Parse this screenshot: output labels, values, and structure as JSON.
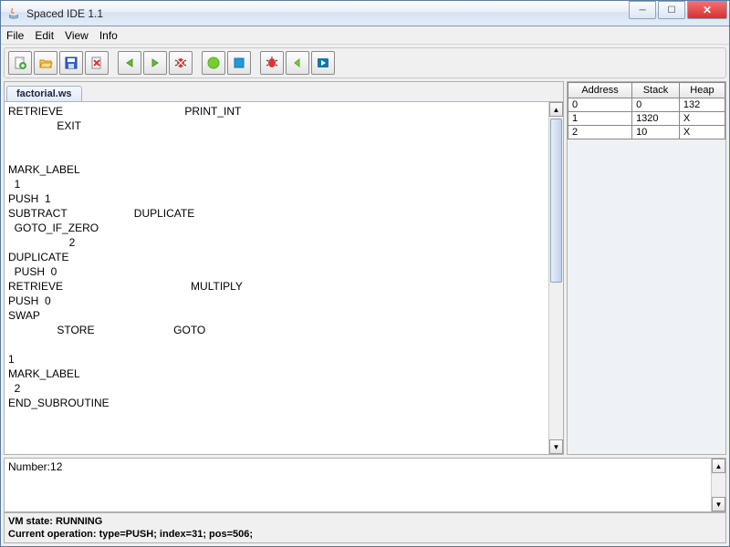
{
  "window": {
    "title": "Spaced IDE 1.1"
  },
  "menu": {
    "file": "File",
    "edit": "Edit",
    "view": "View",
    "info": "Info"
  },
  "toolbar": {
    "icons": [
      "new",
      "open",
      "save",
      "delete",
      "back",
      "forward",
      "debug-stop",
      "run",
      "stop",
      "bug",
      "step-back",
      "step-forward"
    ]
  },
  "tabs": {
    "active": "factorial.ws"
  },
  "editor": {
    "content": "RETRIEVE                                        PRINT_INT\n                EXIT\n\n\nMARK_LABEL\n  1\nPUSH  1\nSUBTRACT                      DUPLICATE\n  GOTO_IF_ZERO\n                    2\nDUPLICATE\n  PUSH  0\nRETRIEVE                                          MULTIPLY\nPUSH  0\nSWAP\n                STORE                          GOTO\n\n1\nMARK_LABEL\n  2\nEND_SUBROUTINE"
  },
  "memory": {
    "headers": {
      "address": "Address",
      "stack": "Stack",
      "heap": "Heap"
    },
    "rows": [
      {
        "address": "0",
        "stack": "0",
        "heap": "132"
      },
      {
        "address": "1",
        "stack": "1320",
        "heap": "X"
      },
      {
        "address": "2",
        "stack": "10",
        "heap": "X"
      }
    ]
  },
  "output": {
    "text": "Number:12"
  },
  "status": {
    "vm": "VM state: RUNNING",
    "op": "Current operation: type=PUSH; index=31; pos=506;"
  },
  "colors": {
    "green": "#4caf50",
    "blue": "#1976d2",
    "red": "#d32f2f",
    "yellow": "#fbc02d",
    "orange": "#ff9800"
  }
}
